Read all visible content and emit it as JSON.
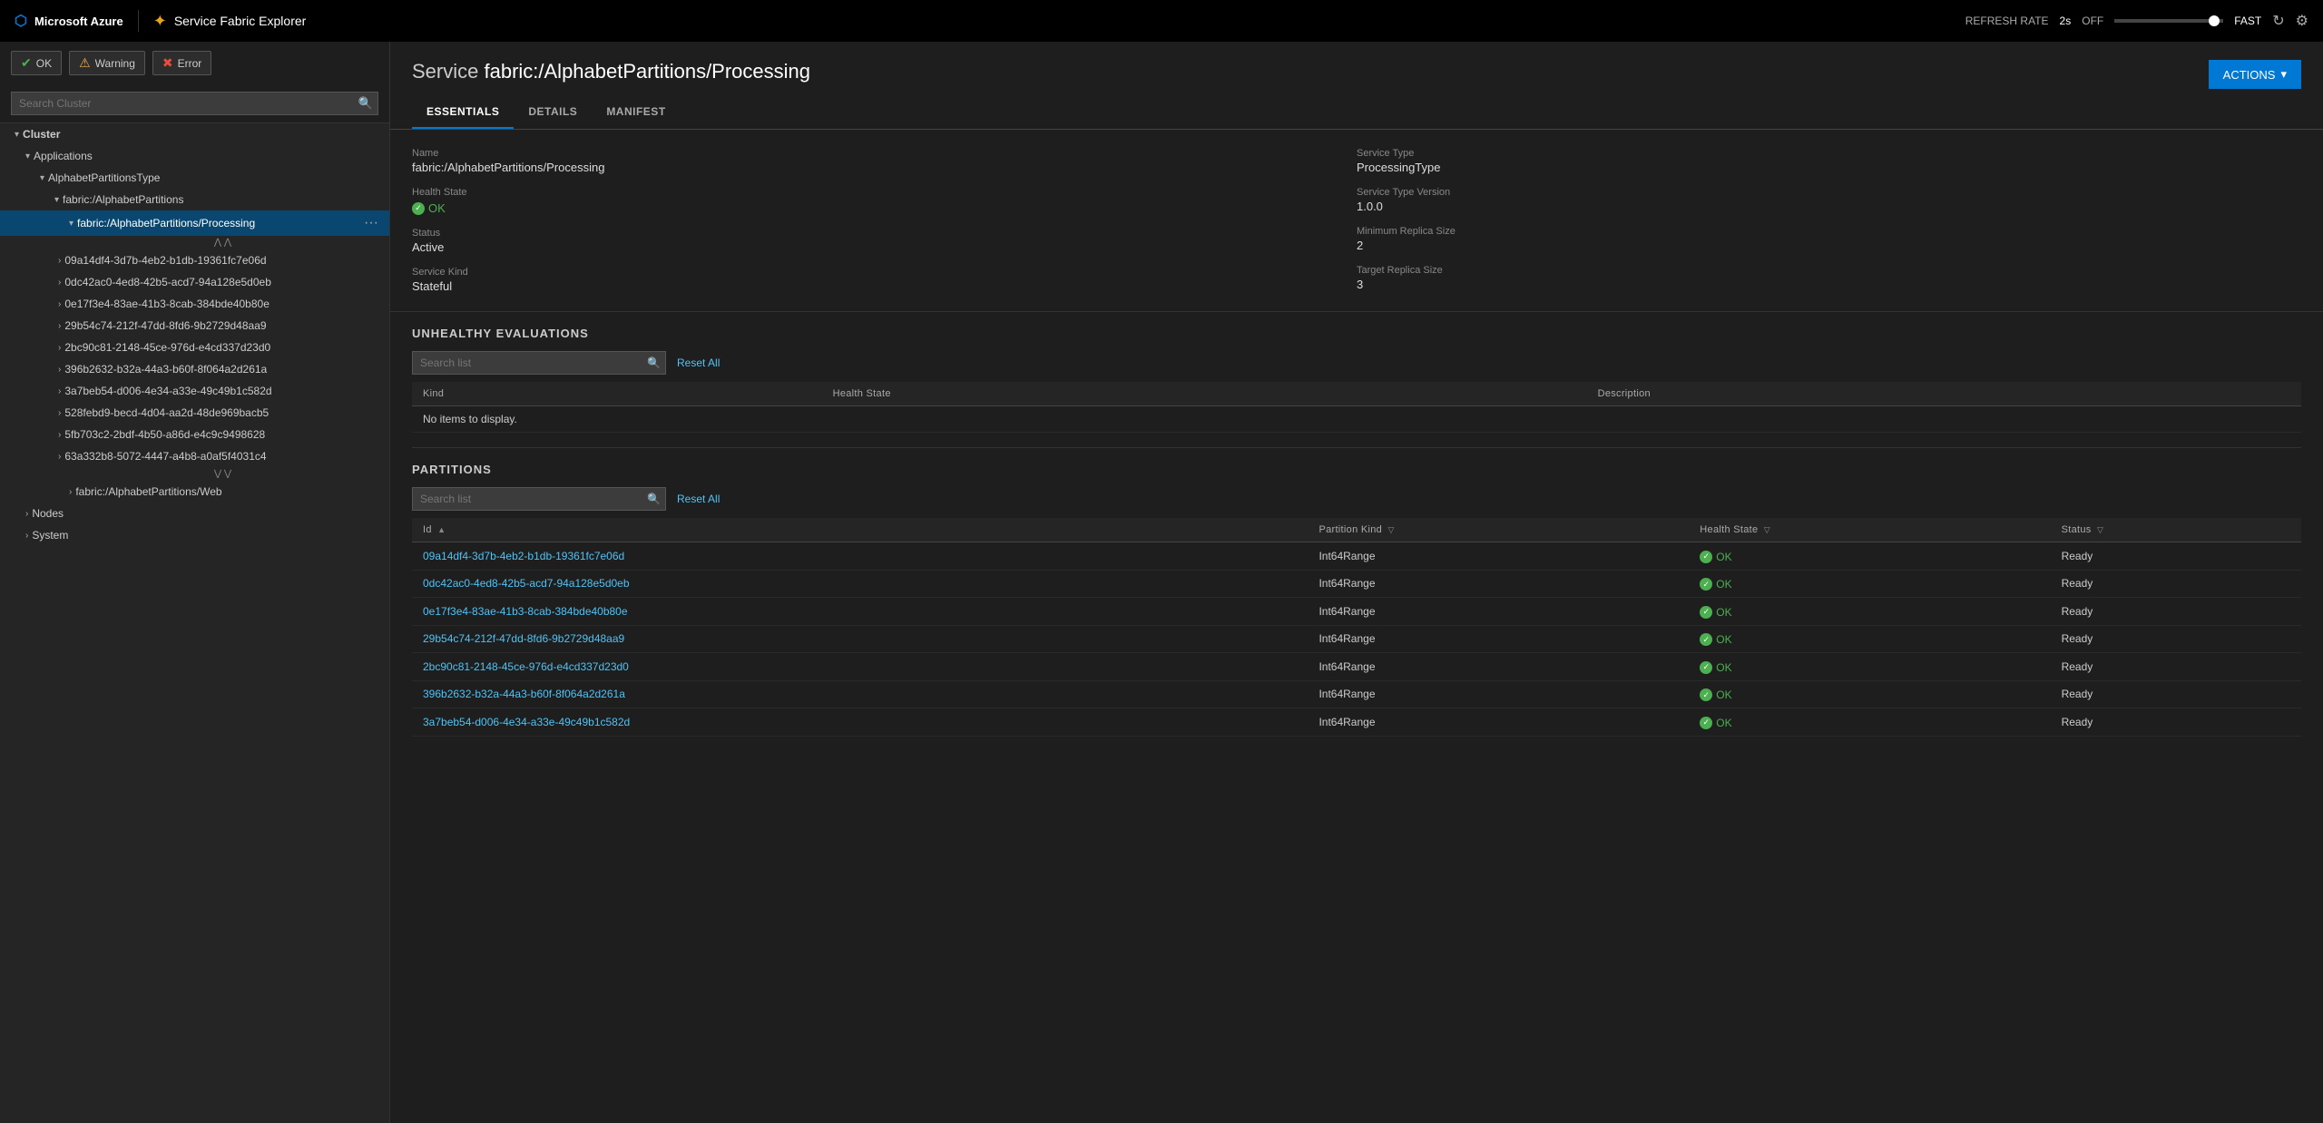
{
  "topnav": {
    "azure_label": "Microsoft Azure",
    "app_title": "Service Fabric Explorer",
    "refresh_label": "REFRESH RATE",
    "refresh_value": "2s",
    "toggle_off": "OFF",
    "fast_label": "FAST"
  },
  "sidebar": {
    "search_placeholder": "Search Cluster",
    "buttons": {
      "ok": "OK",
      "warning": "Warning",
      "error": "Error"
    },
    "tree": [
      {
        "label": "Cluster",
        "level": 0,
        "expanded": true,
        "type": "group"
      },
      {
        "label": "Applications",
        "level": 1,
        "expanded": true,
        "type": "group"
      },
      {
        "label": "AlphabetPartitionsType",
        "level": 2,
        "expanded": true,
        "type": "group"
      },
      {
        "label": "fabric:/AlphabetPartitions",
        "level": 3,
        "expanded": true,
        "type": "group"
      },
      {
        "label": "fabric:/AlphabetPartitions/Processing",
        "level": 4,
        "active": true,
        "type": "item"
      },
      {
        "label": "collapse",
        "type": "collapse-arrows-up"
      },
      {
        "label": "09a14df4-3d7b-4eb2-b1db-19361fc7e06d",
        "level": 5,
        "type": "partition"
      },
      {
        "label": "0dc42ac0-4ed8-42b5-acd7-94a128e5d0eb",
        "level": 5,
        "type": "partition"
      },
      {
        "label": "0e17f3e4-83ae-41b3-8cab-384bde40b80e",
        "level": 5,
        "type": "partition"
      },
      {
        "label": "29b54c74-212f-47dd-8fd6-9b2729d48aa9",
        "level": 5,
        "type": "partition"
      },
      {
        "label": "2bc90c81-2148-45ce-976d-e4cd337d23d0",
        "level": 5,
        "type": "partition"
      },
      {
        "label": "396b2632-b32a-44a3-b60f-8f064a2d261a",
        "level": 5,
        "type": "partition"
      },
      {
        "label": "3a7beb54-d006-4e34-a33e-49c49b1c582d",
        "level": 5,
        "type": "partition"
      },
      {
        "label": "528febd9-becd-4d04-aa2d-48de969bacb5",
        "level": 5,
        "type": "partition"
      },
      {
        "label": "5fb703c2-2bdf-4b50-a86d-e4c9c9498628",
        "level": 5,
        "type": "partition"
      },
      {
        "label": "63a332b8-5072-4447-a4b8-a0af5f4031c4",
        "level": 5,
        "type": "partition"
      },
      {
        "label": "collapse-down",
        "type": "collapse-arrows-down"
      },
      {
        "label": "fabric:/AlphabetPartitions/Web",
        "level": 4,
        "type": "item"
      },
      {
        "label": "Nodes",
        "level": 1,
        "type": "group"
      },
      {
        "label": "System",
        "level": 1,
        "type": "group"
      }
    ]
  },
  "content": {
    "service_prefix": "Service",
    "service_name": "fabric:/AlphabetPartitions/Processing",
    "actions_label": "ACTIONS",
    "tabs": [
      "ESSENTIALS",
      "DETAILS",
      "MANIFEST"
    ],
    "active_tab": "ESSENTIALS",
    "essentials": {
      "name_label": "Name",
      "name_value": "fabric:/AlphabetPartitions/Processing",
      "health_label": "Health State",
      "health_value": "OK",
      "status_label": "Status",
      "status_value": "Active",
      "service_kind_label": "Service Kind",
      "service_kind_value": "Stateful",
      "service_type_label": "Service Type",
      "service_type_value": "ProcessingType",
      "service_type_version_label": "Service Type Version",
      "service_type_version_value": "1.0.0",
      "min_replica_label": "Minimum Replica Size",
      "min_replica_value": "2",
      "target_replica_label": "Target Replica Size",
      "target_replica_value": "3"
    },
    "unhealthy": {
      "title": "UNHEALTHY EVALUATIONS",
      "search_placeholder": "Search list",
      "reset_all": "Reset All",
      "columns": [
        "Kind",
        "Health State",
        "Description"
      ],
      "no_items": "No items to display."
    },
    "partitions": {
      "title": "PARTITIONS",
      "search_placeholder": "Search list",
      "reset_all": "Reset All",
      "columns": [
        "Id",
        "Partition Kind",
        "Health State",
        "Status"
      ],
      "rows": [
        {
          "id": "09a14df4-3d7b-4eb2-b1db-19361fc7e06d",
          "kind": "Int64Range",
          "health": "OK",
          "status": "Ready"
        },
        {
          "id": "0dc42ac0-4ed8-42b5-acd7-94a128e5d0eb",
          "kind": "Int64Range",
          "health": "OK",
          "status": "Ready"
        },
        {
          "id": "0e17f3e4-83ae-41b3-8cab-384bde40b80e",
          "kind": "Int64Range",
          "health": "OK",
          "status": "Ready"
        },
        {
          "id": "29b54c74-212f-47dd-8fd6-9b2729d48aa9",
          "kind": "Int64Range",
          "health": "OK",
          "status": "Ready"
        },
        {
          "id": "2bc90c81-2148-45ce-976d-e4cd337d23d0",
          "kind": "Int64Range",
          "health": "OK",
          "status": "Ready"
        },
        {
          "id": "396b2632-b32a-44a3-b60f-8f064a2d261a",
          "kind": "Int64Range",
          "health": "OK",
          "status": "Ready"
        },
        {
          "id": "3a7beb54-d006-4e34-a33e-49c49b1c582d",
          "kind": "Int64Range",
          "health": "OK",
          "status": "Ready"
        }
      ]
    }
  }
}
